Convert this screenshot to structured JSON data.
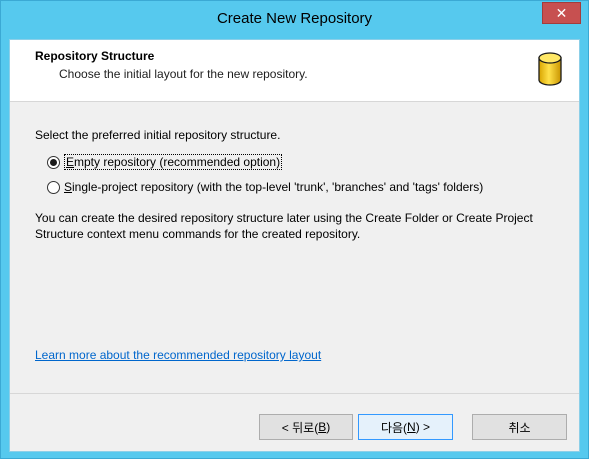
{
  "window": {
    "title": "Create New Repository",
    "close_glyph": "✕"
  },
  "header": {
    "title": "Repository Structure",
    "subtitle": "Choose the initial layout for the new repository.",
    "icon": "database-cylinder-icon"
  },
  "body": {
    "prompt": "Select the preferred initial repository structure.",
    "options": [
      {
        "access_key": "E",
        "rest": "mpty repository (recommended option)",
        "selected": true
      },
      {
        "access_key": "S",
        "rest": "ingle-project repository (with the top-level 'trunk', 'branches' and 'tags' folders)",
        "selected": false
      }
    ],
    "note": "You can create the desired repository structure later using the Create Folder or Create Project Structure context menu commands for the created repository.",
    "learn_more_link": "Learn more about the recommended repository layout"
  },
  "buttons": {
    "back": {
      "prefix": "< 뒤로(",
      "key": "B",
      "suffix": ")"
    },
    "next": {
      "prefix": "다음(",
      "key": "N",
      "suffix": ") >"
    },
    "cancel": "취소"
  },
  "colors": {
    "titlebar": "#56c9ee",
    "close_button": "#c75050",
    "link": "#0066cc",
    "default_button_border": "#3399ff"
  }
}
